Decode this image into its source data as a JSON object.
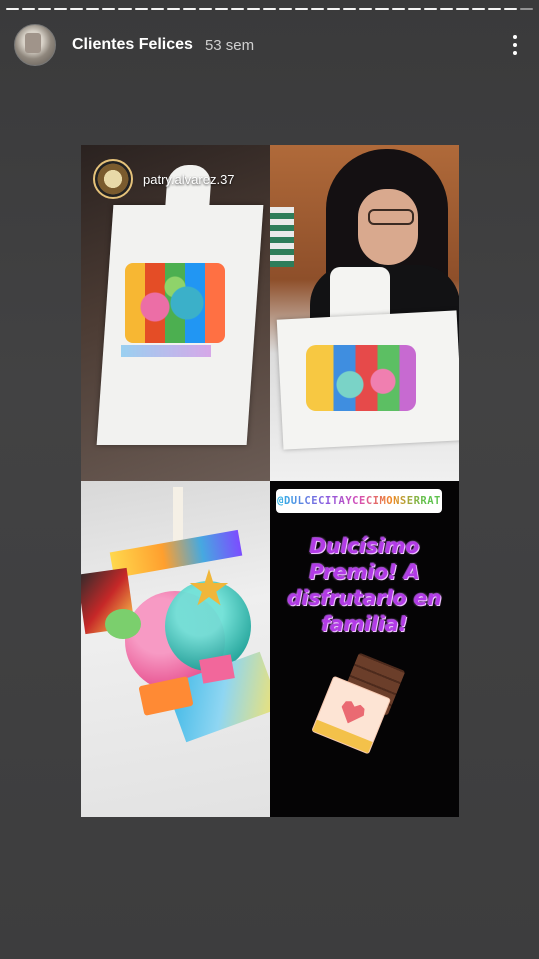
{
  "story": {
    "progress_segments": 33,
    "progress_done": 32
  },
  "header": {
    "username": "Clientes Felices",
    "time_ago": "53 sem",
    "avatar_icon": "profile-avatar",
    "menu_icon": "more-vertical-icon"
  },
  "collage": {
    "overlay_username": "patry.alvarez.37",
    "mention_tag": "@DULCECITAYCECIMONSERRAT",
    "promo_text": "Dulcísimo\nPremio! A\ndisfrutarlo en\nfamilia!",
    "sticker_icon": "chocolate-bar-heart-icon"
  },
  "colors": {
    "background": "#3f3f40",
    "promo_text": "#b23be6",
    "promo_panel": "#050405"
  }
}
